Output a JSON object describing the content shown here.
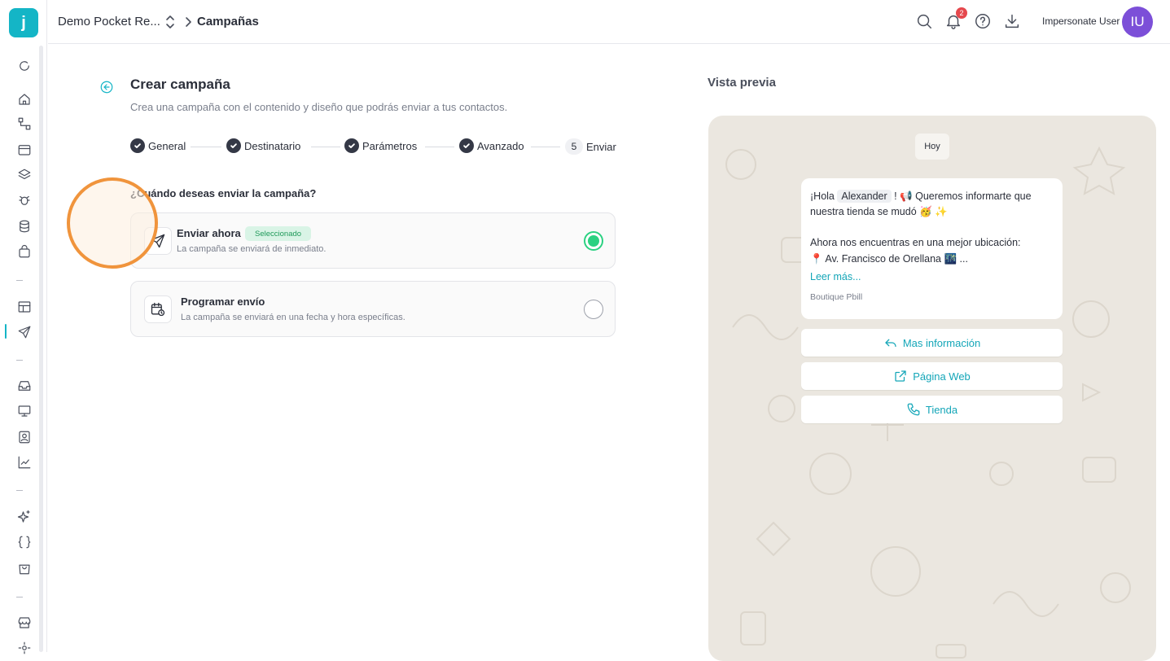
{
  "app": {
    "logo_letter": "j"
  },
  "header": {
    "account": "Demo Pocket Re...",
    "current_page": "Campañas",
    "notifications_count": "2",
    "user_name": "Impersonate User",
    "user_initials": "IU"
  },
  "sidebar": {
    "icons": [
      "refresh-icon",
      "home-icon",
      "flow-icon",
      "archive-icon",
      "layers-icon",
      "bug-icon",
      "database-icon",
      "bag-icon",
      "layout-icon",
      "send-icon",
      "inbox-icon",
      "monitor-icon",
      "contacts-icon",
      "chart-icon",
      "sparkles-icon",
      "braces-icon",
      "shopping-bag-icon",
      "store-icon",
      "settings-icon"
    ],
    "active": "send-icon"
  },
  "form": {
    "title": "Crear campaña",
    "subtitle": "Crea una campaña con el contenido y diseño que podrás enviar a tus contactos.",
    "steps": [
      {
        "label": "General",
        "done": true
      },
      {
        "label": "Destinatario",
        "done": true
      },
      {
        "label": "Parámetros",
        "done": true
      },
      {
        "label": "Avanzado",
        "done": true
      },
      {
        "label": "Enviar",
        "number": "5",
        "done": false
      }
    ],
    "question": "¿Cuándo deseas enviar la campaña?",
    "options": [
      {
        "title": "Enviar ahora",
        "badge": "Seleccionado",
        "description": "La campaña se enviará de inmediato.",
        "selected": true
      },
      {
        "title": "Programar envío",
        "description": "La campaña se enviará en una fecha y hora específicas.",
        "selected": false
      }
    ]
  },
  "preview": {
    "label": "Vista previa",
    "date_pill": "Hoy",
    "message": {
      "line1_prefix": "¡Hola",
      "variable": "Alexander",
      "line1_suffix": "! 📢 Queremos informarte que",
      "line2": "nuestra tienda se mudó 🥳 ✨",
      "line3": "Ahora nos encuentras en una mejor ubicación:",
      "line4": "📍 Av. Francisco de Orellana 🌃 ...",
      "read_more": "Leer más...",
      "sender": "Boutique Pbill"
    },
    "buttons": [
      {
        "label": "Mas información",
        "icon": "reply-icon"
      },
      {
        "label": "Página Web",
        "icon": "external-link-icon"
      },
      {
        "label": "Tienda",
        "icon": "phone-icon"
      }
    ]
  },
  "colors": {
    "brand": "#14b5c6",
    "avatar": "#7c4fd8",
    "selected": "#2bd181",
    "badge_bg": "#d9f4e6",
    "cursor_ring": "#f0943c"
  }
}
